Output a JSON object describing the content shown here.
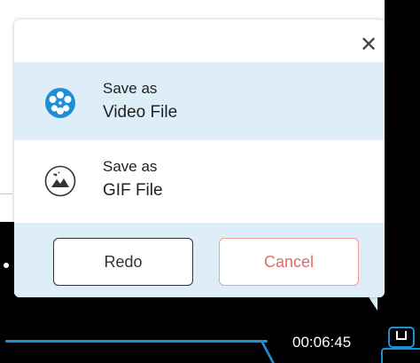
{
  "dialog": {
    "close_glyph": "✕",
    "options": [
      {
        "line1": "Save as",
        "line2": "Video File",
        "icon": "film-reel-icon"
      },
      {
        "line1": "Save as",
        "line2": "GIF File",
        "icon": "image-icon"
      }
    ],
    "redo_label": "Redo",
    "cancel_label": "Cancel"
  },
  "player": {
    "timestamp": "00:06:45"
  },
  "colors": {
    "accent": "#1e8fd6",
    "highlight_bg": "#ddeef8",
    "cancel_text": "#e06a6a"
  }
}
